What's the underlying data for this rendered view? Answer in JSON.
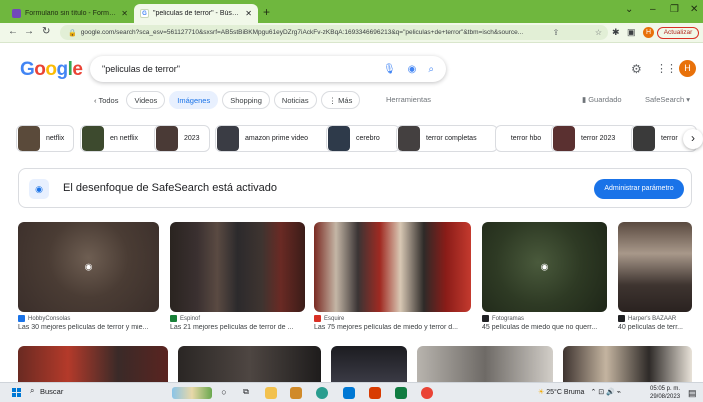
{
  "browser": {
    "tabs": [
      {
        "title": "Formulario sin título - Formularios",
        "active": false
      },
      {
        "title": "\"peliculas de terror\" - Búsqueda",
        "active": true
      }
    ],
    "url": "google.com/search?sca_esv=561127710&sxsrf=AB5stBiBKMpgu61eyDZrg7iAckFv-zKBqA:1693346696213&q=\"peliculas+de+terror\"&tbm=isch&source...",
    "update_label": "Actualizar",
    "profile_initial": "H"
  },
  "google": {
    "logo_letters": [
      "G",
      "o",
      "o",
      "g",
      "l",
      "e"
    ],
    "query": "\"peliculas de terror\"",
    "avatar_initial": "H",
    "filters": [
      "‹ Todos",
      "Videos",
      "Imágenes",
      "Shopping",
      "Noticias",
      "⋮ Más"
    ],
    "selected_filter": "Imágenes",
    "tools_label": "Herramientas",
    "saved_label": "Guardado",
    "safesearch_label": "SafeSearch ▾"
  },
  "related": [
    {
      "label": "netflix",
      "color": "#5a4a3a"
    },
    {
      "label": "en netflix",
      "color": "#3d4a2e"
    },
    {
      "label": "2023",
      "color": "#4a3a36"
    },
    {
      "label": "amazon prime video",
      "color": "#3a3c44"
    },
    {
      "label": "cerebro",
      "color": "#2e3a4a"
    },
    {
      "label": "terror completas",
      "color": "#444040"
    },
    {
      "label": "terror hbo",
      "color": ""
    },
    {
      "label": "terror 2023",
      "color": "#5a3030"
    },
    {
      "label": "terror",
      "color": "#3a3a3a"
    }
  ],
  "banner": {
    "message": "El desenfoque de SafeSearch está activado",
    "button": "Administrar parámetro"
  },
  "results": [
    {
      "source": "HobbyConsolas",
      "caption": "Las 30 mejores películas de terror y mie...",
      "blurred": true,
      "fav": "#1a73e8"
    },
    {
      "source": "Espinof",
      "caption": "Las 21 mejores películas de terror de ...",
      "blurred": false,
      "fav": "#188038"
    },
    {
      "source": "Esquire",
      "caption": "Las 75 mejores películas de miedo y terror d...",
      "blurred": false,
      "fav": "#d93025"
    },
    {
      "source": "Fotogramas",
      "caption": "45 películas de miedo que no querr...",
      "blurred": true,
      "fav": "#202124"
    },
    {
      "source": "Harper's BAZAAR",
      "caption": "40 películas de terr...",
      "blurred": false,
      "fav": "#202124"
    }
  ],
  "taskbar": {
    "search_label": "Buscar",
    "weather": "25°C  Bruma",
    "time": "05:05 p. m.",
    "date": "29/08/2023"
  }
}
